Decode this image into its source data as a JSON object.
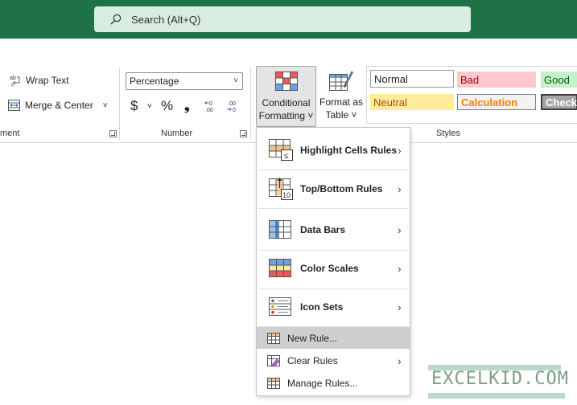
{
  "titlebar": {
    "search_placeholder": "Search (Alt+Q)",
    "bg_color": "#1f7246"
  },
  "ribbon": {
    "alignment": {
      "wrap_text_label": "Wrap Text",
      "merge_center_label": "Merge & Center",
      "group_label": "ment"
    },
    "number": {
      "format_value": "Percentage",
      "currency_symbol": "$",
      "percent_symbol": "%",
      "comma_symbol": "❟",
      "inc_decimal": "←0\n.00",
      "dec_decimal": ".00\n→0",
      "group_label": "Number"
    },
    "conditional_formatting": {
      "line1": "Conditional",
      "line2": "Formatting ˅"
    },
    "format_as_table": {
      "line1": "Format as",
      "line2": "Table ˅"
    },
    "styles": {
      "group_label": "Styles",
      "normal": "Normal",
      "bad": "Bad",
      "good": "Good",
      "neutral": "Neutral",
      "calculation": "Calculation",
      "check_cell": "Check"
    }
  },
  "menu": {
    "items": [
      {
        "label": "Highlight Cells Rules",
        "icon": "highlight-cells-icon",
        "submenu": true
      },
      {
        "label": "Top/Bottom Rules",
        "icon": "top-bottom-icon",
        "submenu": true
      },
      {
        "label": "Data Bars",
        "icon": "data-bars-icon",
        "submenu": true
      },
      {
        "label": "Color Scales",
        "icon": "color-scales-icon",
        "submenu": true
      },
      {
        "label": "Icon Sets",
        "icon": "icon-sets-icon",
        "submenu": true
      },
      {
        "label": "New Rule...",
        "icon": "new-rule-icon",
        "submenu": false,
        "selected": true
      },
      {
        "label": "Clear Rules",
        "icon": "clear-rules-icon",
        "submenu": true
      },
      {
        "label": "Manage Rules...",
        "icon": "manage-rules-icon",
        "submenu": false
      }
    ],
    "submenu_arrow": "›"
  },
  "watermark": {
    "text": "EXCELKID.COM"
  }
}
